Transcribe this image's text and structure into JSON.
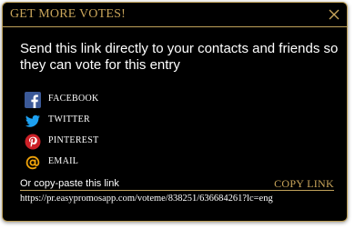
{
  "modal": {
    "title": "GET MORE VOTES!",
    "intro_text": "Send this link directly to your contacts and friends so they can vote for this entry",
    "share_options": [
      {
        "label": "FACEBOOK",
        "icon": "facebook-icon",
        "color": "#3b5998"
      },
      {
        "label": "TWITTER",
        "icon": "twitter-icon",
        "color": "#1da1f2"
      },
      {
        "label": "PINTEREST",
        "icon": "pinterest-icon",
        "color": "#cb2027"
      },
      {
        "label": "EMAIL",
        "icon": "email-at-icon",
        "color": "#f0a30a"
      }
    ],
    "copy_label": "Or copy-paste this link",
    "copy_button": "COPY LINK",
    "url": "https://pr.easypromosapp.com/voteme/838251/636684261?lc=eng"
  },
  "colors": {
    "background": "#000000",
    "accent_gold": "#c9a55a",
    "text": "#ffffff"
  }
}
